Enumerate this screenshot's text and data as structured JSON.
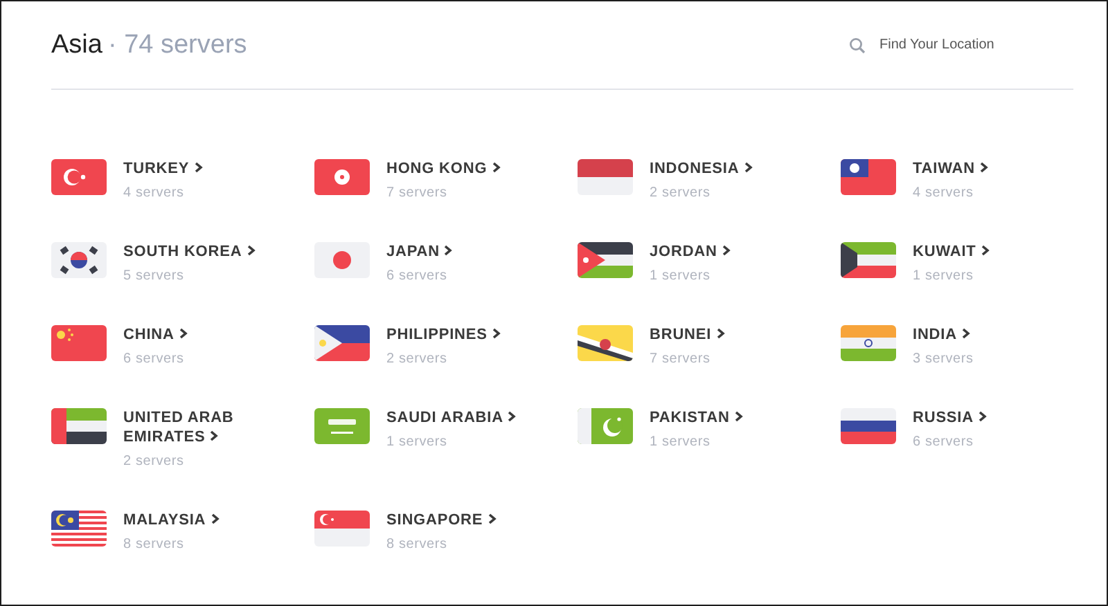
{
  "header": {
    "title": "Asia",
    "count": "· 74 servers"
  },
  "search": {
    "placeholder": "Find Your Location"
  },
  "countries": [
    {
      "kind": "turkey",
      "name": "TURKEY",
      "servers": "4 servers"
    },
    {
      "kind": "hongkong",
      "name": "HONG KONG",
      "servers": "7 servers"
    },
    {
      "kind": "indonesia",
      "name": "INDONESIA",
      "servers": "2 servers"
    },
    {
      "kind": "taiwan",
      "name": "TAIWAN",
      "servers": "4 servers"
    },
    {
      "kind": "southkorea",
      "name": "SOUTH KOREA",
      "servers": "5 servers"
    },
    {
      "kind": "japan",
      "name": "JAPAN",
      "servers": "6 servers"
    },
    {
      "kind": "jordan",
      "name": "JORDAN",
      "servers": "1 servers"
    },
    {
      "kind": "kuwait",
      "name": "KUWAIT",
      "servers": "1 servers"
    },
    {
      "kind": "china",
      "name": "CHINA",
      "servers": "6 servers"
    },
    {
      "kind": "philippines",
      "name": "PHILIPPINES",
      "servers": "2 servers"
    },
    {
      "kind": "brunei",
      "name": "BRUNEI",
      "servers": "7 servers"
    },
    {
      "kind": "india",
      "name": "INDIA",
      "servers": "3 servers"
    },
    {
      "kind": "uae",
      "name": "UNITED ARAB EMIRATES",
      "servers": "2 servers"
    },
    {
      "kind": "saudi",
      "name": "SAUDI ARABIA",
      "servers": "1 servers"
    },
    {
      "kind": "pakistan",
      "name": "PAKISTAN",
      "servers": "1 servers"
    },
    {
      "kind": "russia",
      "name": "RUSSIA",
      "servers": "6 servers"
    },
    {
      "kind": "malaysia",
      "name": "MALAYSIA",
      "servers": "8 servers"
    },
    {
      "kind": "singapore",
      "name": "SINGAPORE",
      "servers": "8 servers"
    }
  ]
}
